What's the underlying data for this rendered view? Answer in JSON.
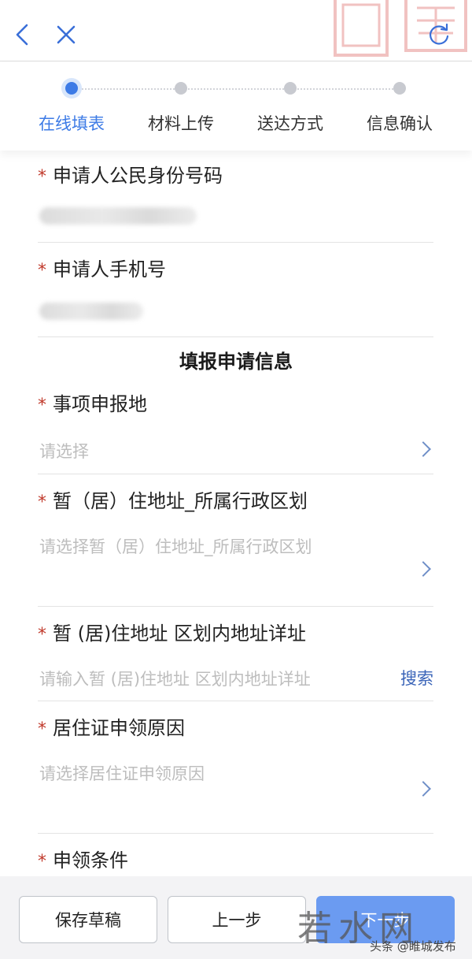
{
  "header": {
    "back_icon": "chevron-left-icon",
    "close_icon": "close-icon",
    "refresh_icon": "refresh-icon",
    "accent": "#3d7be6"
  },
  "steps": [
    {
      "label": "在线填表",
      "active": true
    },
    {
      "label": "材料上传",
      "active": false
    },
    {
      "label": "送达方式",
      "active": false
    },
    {
      "label": "信息确认",
      "active": false
    }
  ],
  "form": {
    "id_number": {
      "label": "申请人公民身份号码",
      "required": true
    },
    "phone": {
      "label": "申请人手机号",
      "required": true
    },
    "section_title": "填报申请信息",
    "location": {
      "label": "事项申报地",
      "placeholder": "请选择",
      "required": true
    },
    "region": {
      "label": "暂（居）住地址_所属行政区划",
      "placeholder": "请选择暂（居）住地址_所属行政区划",
      "required": true
    },
    "address": {
      "label": "暂 (居)住地址 区划内地址详址",
      "placeholder": "请输入暂 (居)住地址 区划内地址详址",
      "search_label": "搜索",
      "required": true
    },
    "reason": {
      "label": "居住证申领原因",
      "placeholder": "请选择居住证申领原因",
      "required": true
    },
    "conditions": {
      "label": "申领条件",
      "required": true
    }
  },
  "footer": {
    "save_draft": "保存草稿",
    "prev": "上一步",
    "next": "下一步",
    "watermark_logo": "若水网",
    "watermark_text": "头条 @睢城发布"
  },
  "required_mark": "*"
}
